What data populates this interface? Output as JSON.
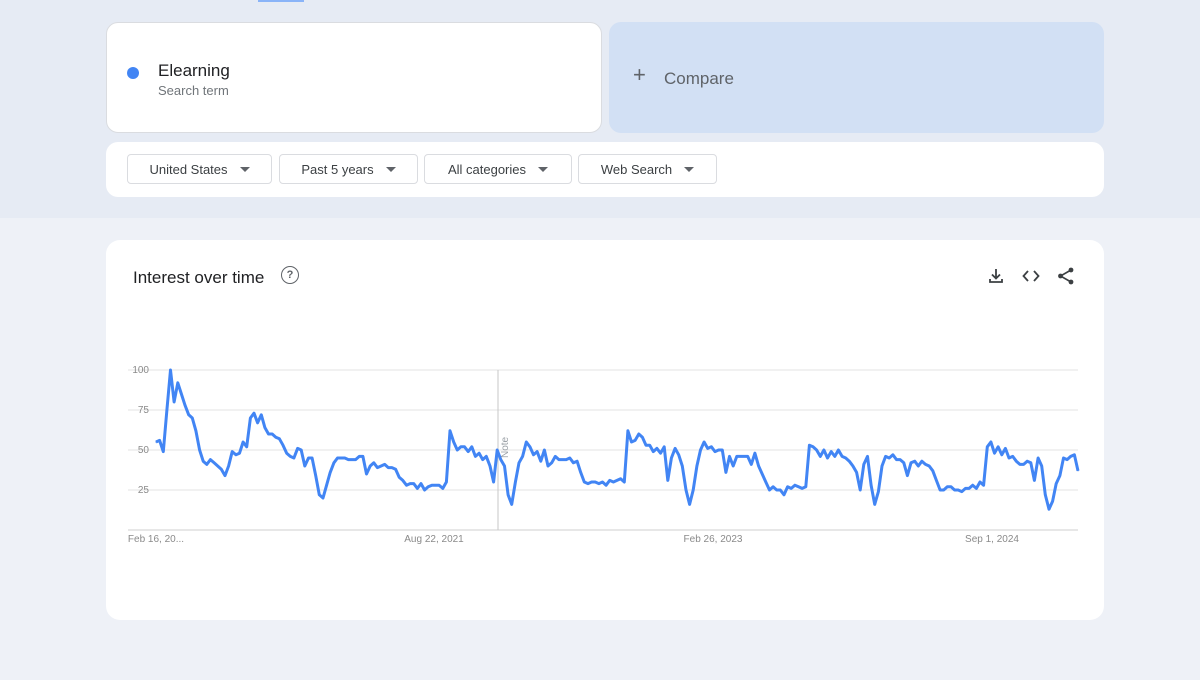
{
  "search_term": {
    "name": "Elearning",
    "subtitle": "Search term",
    "color": "#4285f4"
  },
  "compare": {
    "plus": "+",
    "label": "Compare"
  },
  "filters": [
    {
      "label": "United States"
    },
    {
      "label": "Past 5 years"
    },
    {
      "label": "All categories"
    },
    {
      "label": "Web Search"
    }
  ],
  "chart_panel": {
    "title": "Interest over time",
    "help_icon": "help-circle-icon",
    "actions": [
      "download-icon",
      "embed-code-icon",
      "share-icon"
    ],
    "note_label": "Note"
  },
  "chart_data": {
    "type": "line",
    "x_labels": [
      "Feb 16, 20...",
      "Aug 22, 2021",
      "Feb 26, 2023",
      "Sep 1, 2024"
    ],
    "x_range": [
      "2020-02-16",
      "2025-02-16"
    ],
    "y_ticks": [
      100,
      75,
      50,
      25
    ],
    "ylim": [
      0,
      100
    ],
    "grid": true,
    "series": [
      {
        "color": "#4285f4",
        "values": [
          55,
          56,
          49,
          75,
          100,
          80,
          92,
          85,
          78,
          72,
          70,
          62,
          50,
          43,
          41,
          44,
          42,
          40,
          38,
          34,
          40,
          49,
          47,
          48,
          55,
          52,
          70,
          73,
          67,
          72,
          64,
          60,
          60,
          58,
          57,
          53,
          48,
          46,
          45,
          51,
          50,
          40,
          45,
          45,
          34,
          22,
          20,
          28,
          36,
          42,
          45,
          45,
          45,
          44,
          44,
          44,
          46,
          46,
          35,
          40,
          42,
          39,
          40,
          41,
          39,
          39,
          38,
          33,
          31,
          28,
          29,
          29,
          26,
          29,
          25,
          27,
          28,
          28,
          28,
          26,
          30,
          62,
          55,
          50,
          52,
          52,
          49,
          52,
          46,
          48,
          44,
          46,
          40,
          30,
          50,
          44,
          40,
          22,
          16,
          30,
          42,
          46,
          55,
          52,
          47,
          49,
          43,
          50,
          40,
          42,
          46,
          44,
          44,
          44,
          45,
          42,
          43,
          36,
          30,
          29,
          30,
          30,
          29,
          30,
          28,
          31,
          30,
          31,
          32,
          30,
          62,
          55,
          56,
          60,
          58,
          53,
          53,
          49,
          51,
          48,
          52,
          31,
          45,
          51,
          47,
          40,
          25,
          16,
          25,
          40,
          50,
          55,
          51,
          52,
          49,
          50,
          50,
          36,
          46,
          40,
          46,
          46,
          46,
          46,
          41,
          48,
          40,
          35,
          30,
          25,
          27,
          25,
          25,
          22,
          27,
          26,
          28,
          27,
          26,
          27,
          53,
          52,
          50,
          46,
          50,
          45,
          49,
          46,
          50,
          46,
          45,
          43,
          40,
          36,
          25,
          41,
          46,
          28,
          16,
          24,
          40,
          46,
          45,
          47,
          44,
          44,
          42,
          34,
          42,
          43,
          40,
          43,
          41,
          40,
          37,
          31,
          25,
          25,
          27,
          27,
          25,
          25,
          24,
          26,
          26,
          28,
          26,
          30,
          28,
          52,
          55,
          48,
          52,
          47,
          51,
          45,
          46,
          43,
          41,
          41,
          43,
          42,
          31,
          45,
          40,
          22,
          13,
          18,
          29,
          34,
          45,
          44,
          46,
          47,
          37
        ]
      }
    ]
  }
}
